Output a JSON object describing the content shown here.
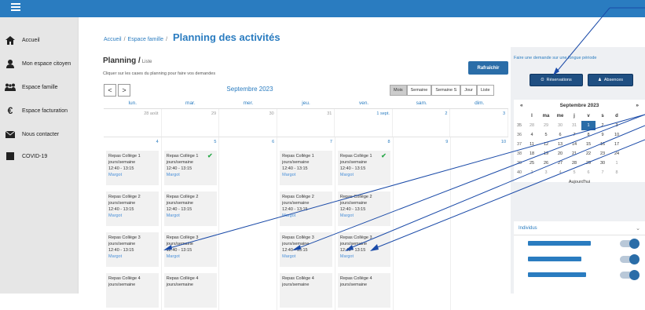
{
  "sidebar": {
    "items": [
      {
        "label": "Accueil",
        "icon": "home-icon"
      },
      {
        "label": "Mon espace citoyen",
        "icon": "user-icon"
      },
      {
        "label": "Espace famille",
        "icon": "family-icon"
      },
      {
        "label": "Espace facturation",
        "icon": "euro-icon"
      },
      {
        "label": "Nous contacter",
        "icon": "mail-icon"
      },
      {
        "label": "COVID-19",
        "icon": "square-icon"
      }
    ]
  },
  "breadcrumb": {
    "home": "Accueil",
    "section": "Espace famille",
    "page": "Planning des activités"
  },
  "planning": {
    "title": "Planning /",
    "mode": "Liste",
    "hint": "Cliquer sur les cases du planning pour faire vos demandes",
    "refresh_label": "Rafraîchir",
    "prev": "<",
    "next": ">",
    "month": "Septembre 2023",
    "views": [
      "Mois",
      "Semaine",
      "Semaine S",
      "Jour",
      "Liste"
    ],
    "active_view": "Mois",
    "days": [
      "lun.",
      "mar.",
      "mer.",
      "jeu.",
      "ven.",
      "sam.",
      "dim."
    ],
    "week1": [
      "28 août",
      "29",
      "30",
      "31",
      "1 sept.",
      "2",
      "3"
    ],
    "week2": [
      "4",
      "5",
      "6",
      "7",
      "8",
      "9",
      "10"
    ],
    "events": {
      "mon": [
        {
          "title": "Repas Collège 1",
          "sub": "jours/semaine",
          "time": "12:40 - 13:15",
          "who": "Margot"
        },
        {
          "title": "Repas Collège 2",
          "sub": "jours/semaine",
          "time": "12:40 - 13:15",
          "who": "Margot"
        },
        {
          "title": "Repas Collège 3",
          "sub": "jours/semaine",
          "time": "12:40 - 13:15",
          "who": "Margot"
        },
        {
          "title": "Repas Collège 4",
          "sub": "jours/semaine"
        }
      ],
      "tue": [
        {
          "title": "Repas Collège 1",
          "sub": "jours/semaine",
          "time": "12:40 - 13:15",
          "who": "Margot"
        },
        {
          "title": "Repas Collège 2",
          "sub": "jours/semaine",
          "time": "12:40 - 13:15",
          "who": "Margot"
        },
        {
          "title": "Repas Collège 3",
          "sub": "jours/semaine",
          "time": "12:40 - 13:15",
          "who": "Margot"
        },
        {
          "title": "Repas Collège 4",
          "sub": "jours/semaine"
        }
      ],
      "thu": [
        {
          "title": "Repas Collège 1",
          "sub": "jours/semaine",
          "time": "12:40 - 13:15",
          "who": "Margot"
        },
        {
          "title": "Repas Collège 2",
          "sub": "jours/semaine",
          "time": "12:40 - 13:15",
          "who": "Margot"
        },
        {
          "title": "Repas Collège 3",
          "sub": "jours/semaine",
          "time": "12:40 - 13:15",
          "who": "Margot"
        },
        {
          "title": "Repas Collège 4",
          "sub": "jours/semaine"
        }
      ],
      "fri": [
        {
          "title": "Repas Collège 1",
          "sub": "jours/semaine",
          "time": "12:40 - 13:15",
          "who": "Margot"
        },
        {
          "title": "Repas Collège 2",
          "sub": "jours/semaine",
          "time": "12:40 - 13:15",
          "who": "Margot"
        },
        {
          "title": "Repas Collège 3",
          "sub": "jours/semaine",
          "time": "12:40 - 13:15",
          "who": "Margot"
        },
        {
          "title": "Repas Collège 4",
          "sub": "jours/semaine"
        }
      ]
    }
  },
  "right": {
    "request_text": "Faire une demande sur une longue période",
    "reservations_label": "Réservations",
    "absences_label": "Absences",
    "cal_prev": "«",
    "cal_title": "Septembre 2023",
    "cal_next": "»",
    "cal_days": [
      "l",
      "ma",
      "me",
      "j",
      "v",
      "s",
      "d"
    ],
    "cal_rows": [
      {
        "wk": "35",
        "d": [
          "28",
          "29",
          "30",
          "31",
          "1",
          "2",
          "3"
        ]
      },
      {
        "wk": "36",
        "d": [
          "4",
          "5",
          "6",
          "7",
          "8",
          "9",
          "10"
        ]
      },
      {
        "wk": "37",
        "d": [
          "11",
          "12",
          "13",
          "14",
          "15",
          "16",
          "17"
        ]
      },
      {
        "wk": "38",
        "d": [
          "18",
          "19",
          "20",
          "21",
          "22",
          "23",
          "24"
        ]
      },
      {
        "wk": "39",
        "d": [
          "25",
          "26",
          "27",
          "28",
          "29",
          "30",
          "1"
        ]
      },
      {
        "wk": "40",
        "d": [
          "2",
          "3",
          "4",
          "5",
          "6",
          "7",
          "8"
        ]
      }
    ],
    "today_label": "Aujourd'hui",
    "individus_label": "Individus"
  }
}
